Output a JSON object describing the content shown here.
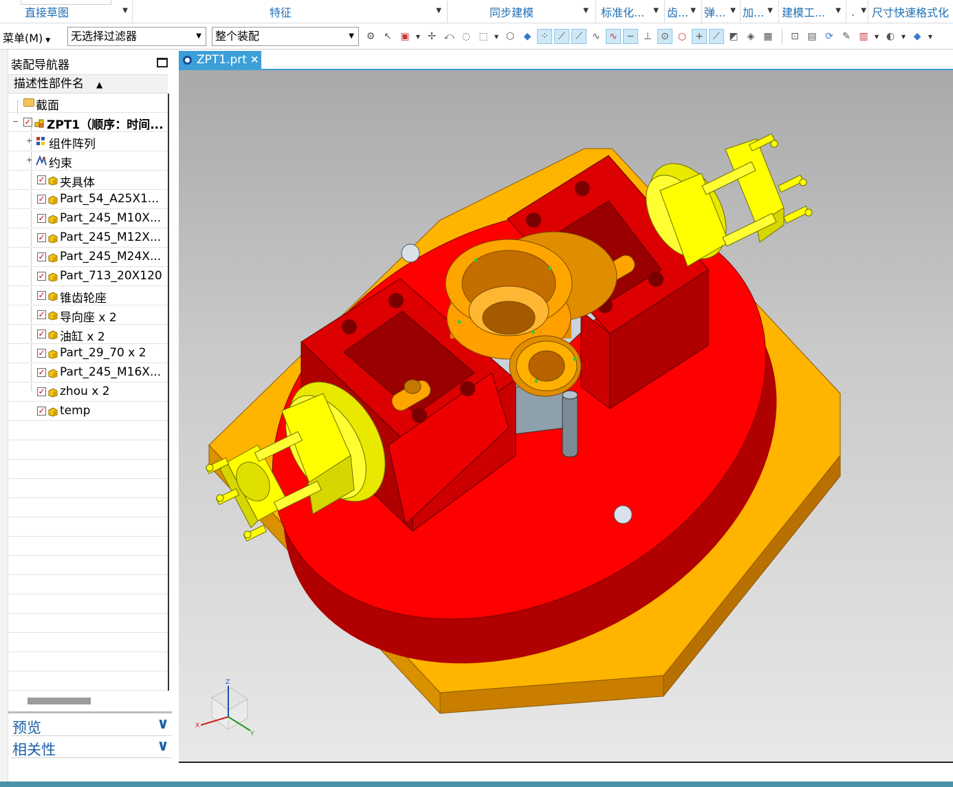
{
  "ribbon": {
    "groups": [
      {
        "label": "直接草图"
      },
      {
        "label": "特征"
      },
      {
        "label": "同步建模"
      },
      {
        "label": "标准化..."
      },
      {
        "label": "齿..."
      },
      {
        "label": "弹..."
      },
      {
        "label": "加..."
      },
      {
        "label": "建模工..."
      },
      {
        "label": "."
      },
      {
        "label": "尺寸快速格式化"
      }
    ]
  },
  "toolbar": {
    "menu_label": "菜单(M)",
    "filter_value": "无选择过滤器",
    "scope_value": "整个装配",
    "icons": [
      "snap-icon",
      "select-arrow-icon",
      "select-box-icon",
      "move-icon",
      "rotate-icon",
      "lasso-icon",
      "rectangle-select-icon",
      "solid-body-icon",
      "cube-icon",
      "point-snap-icon",
      "line-icon",
      "edge-icon",
      "curve-icon",
      "spline-icon",
      "wave-icon",
      "intersect-icon",
      "center-point-icon",
      "circle-point-icon",
      "cross-point-icon",
      "tangent-icon",
      "face-icon",
      "plane-icon",
      "grid-icon",
      "view-fit-icon",
      "render-icon",
      "refresh-icon",
      "paint-icon",
      "layout-icon",
      "shade-icon",
      "cube-view-icon"
    ]
  },
  "navigator": {
    "title": "装配导航器",
    "column_header": "描述性部件名",
    "rows": [
      {
        "label": "截面",
        "type": "folder"
      },
      {
        "label": "ZPT1（顺序：时间...",
        "type": "assembly"
      },
      {
        "label": "组件阵列",
        "type": "array"
      },
      {
        "label": "约束",
        "type": "constraint"
      },
      {
        "label": "夹具体",
        "type": "part"
      },
      {
        "label": "Part_54_A25X1...",
        "type": "part"
      },
      {
        "label": "Part_245_M10X...",
        "type": "part"
      },
      {
        "label": "Part_245_M12X...",
        "type": "part"
      },
      {
        "label": "Part_245_M24X...",
        "type": "part"
      },
      {
        "label": "Part_713_20X120",
        "type": "part"
      },
      {
        "label": "锥齿轮座",
        "type": "part"
      },
      {
        "label": "导向座 x 2",
        "type": "part"
      },
      {
        "label": "油缸 x 2",
        "type": "part"
      },
      {
        "label": "Part_29_70 x 2",
        "type": "part"
      },
      {
        "label": "Part_245_M16X...",
        "type": "part"
      },
      {
        "label": "zhou x 2",
        "type": "part"
      },
      {
        "label": "temp",
        "type": "part"
      }
    ],
    "panels": [
      {
        "label": "预览"
      },
      {
        "label": "相关性"
      }
    ]
  },
  "document": {
    "tab_label": "ZPT1.prt",
    "close_glyph": "×"
  },
  "triad": {
    "x": "X",
    "y": "Y",
    "z": "Z"
  },
  "colors": {
    "ribbon_text": "#1f6fb5",
    "tab_active": "#3c9fd8",
    "red_part": "#ff0000",
    "orange_base": "#ffb400",
    "yellow_cylinder": "#ffff00",
    "status_bar": "#4a93a9"
  }
}
